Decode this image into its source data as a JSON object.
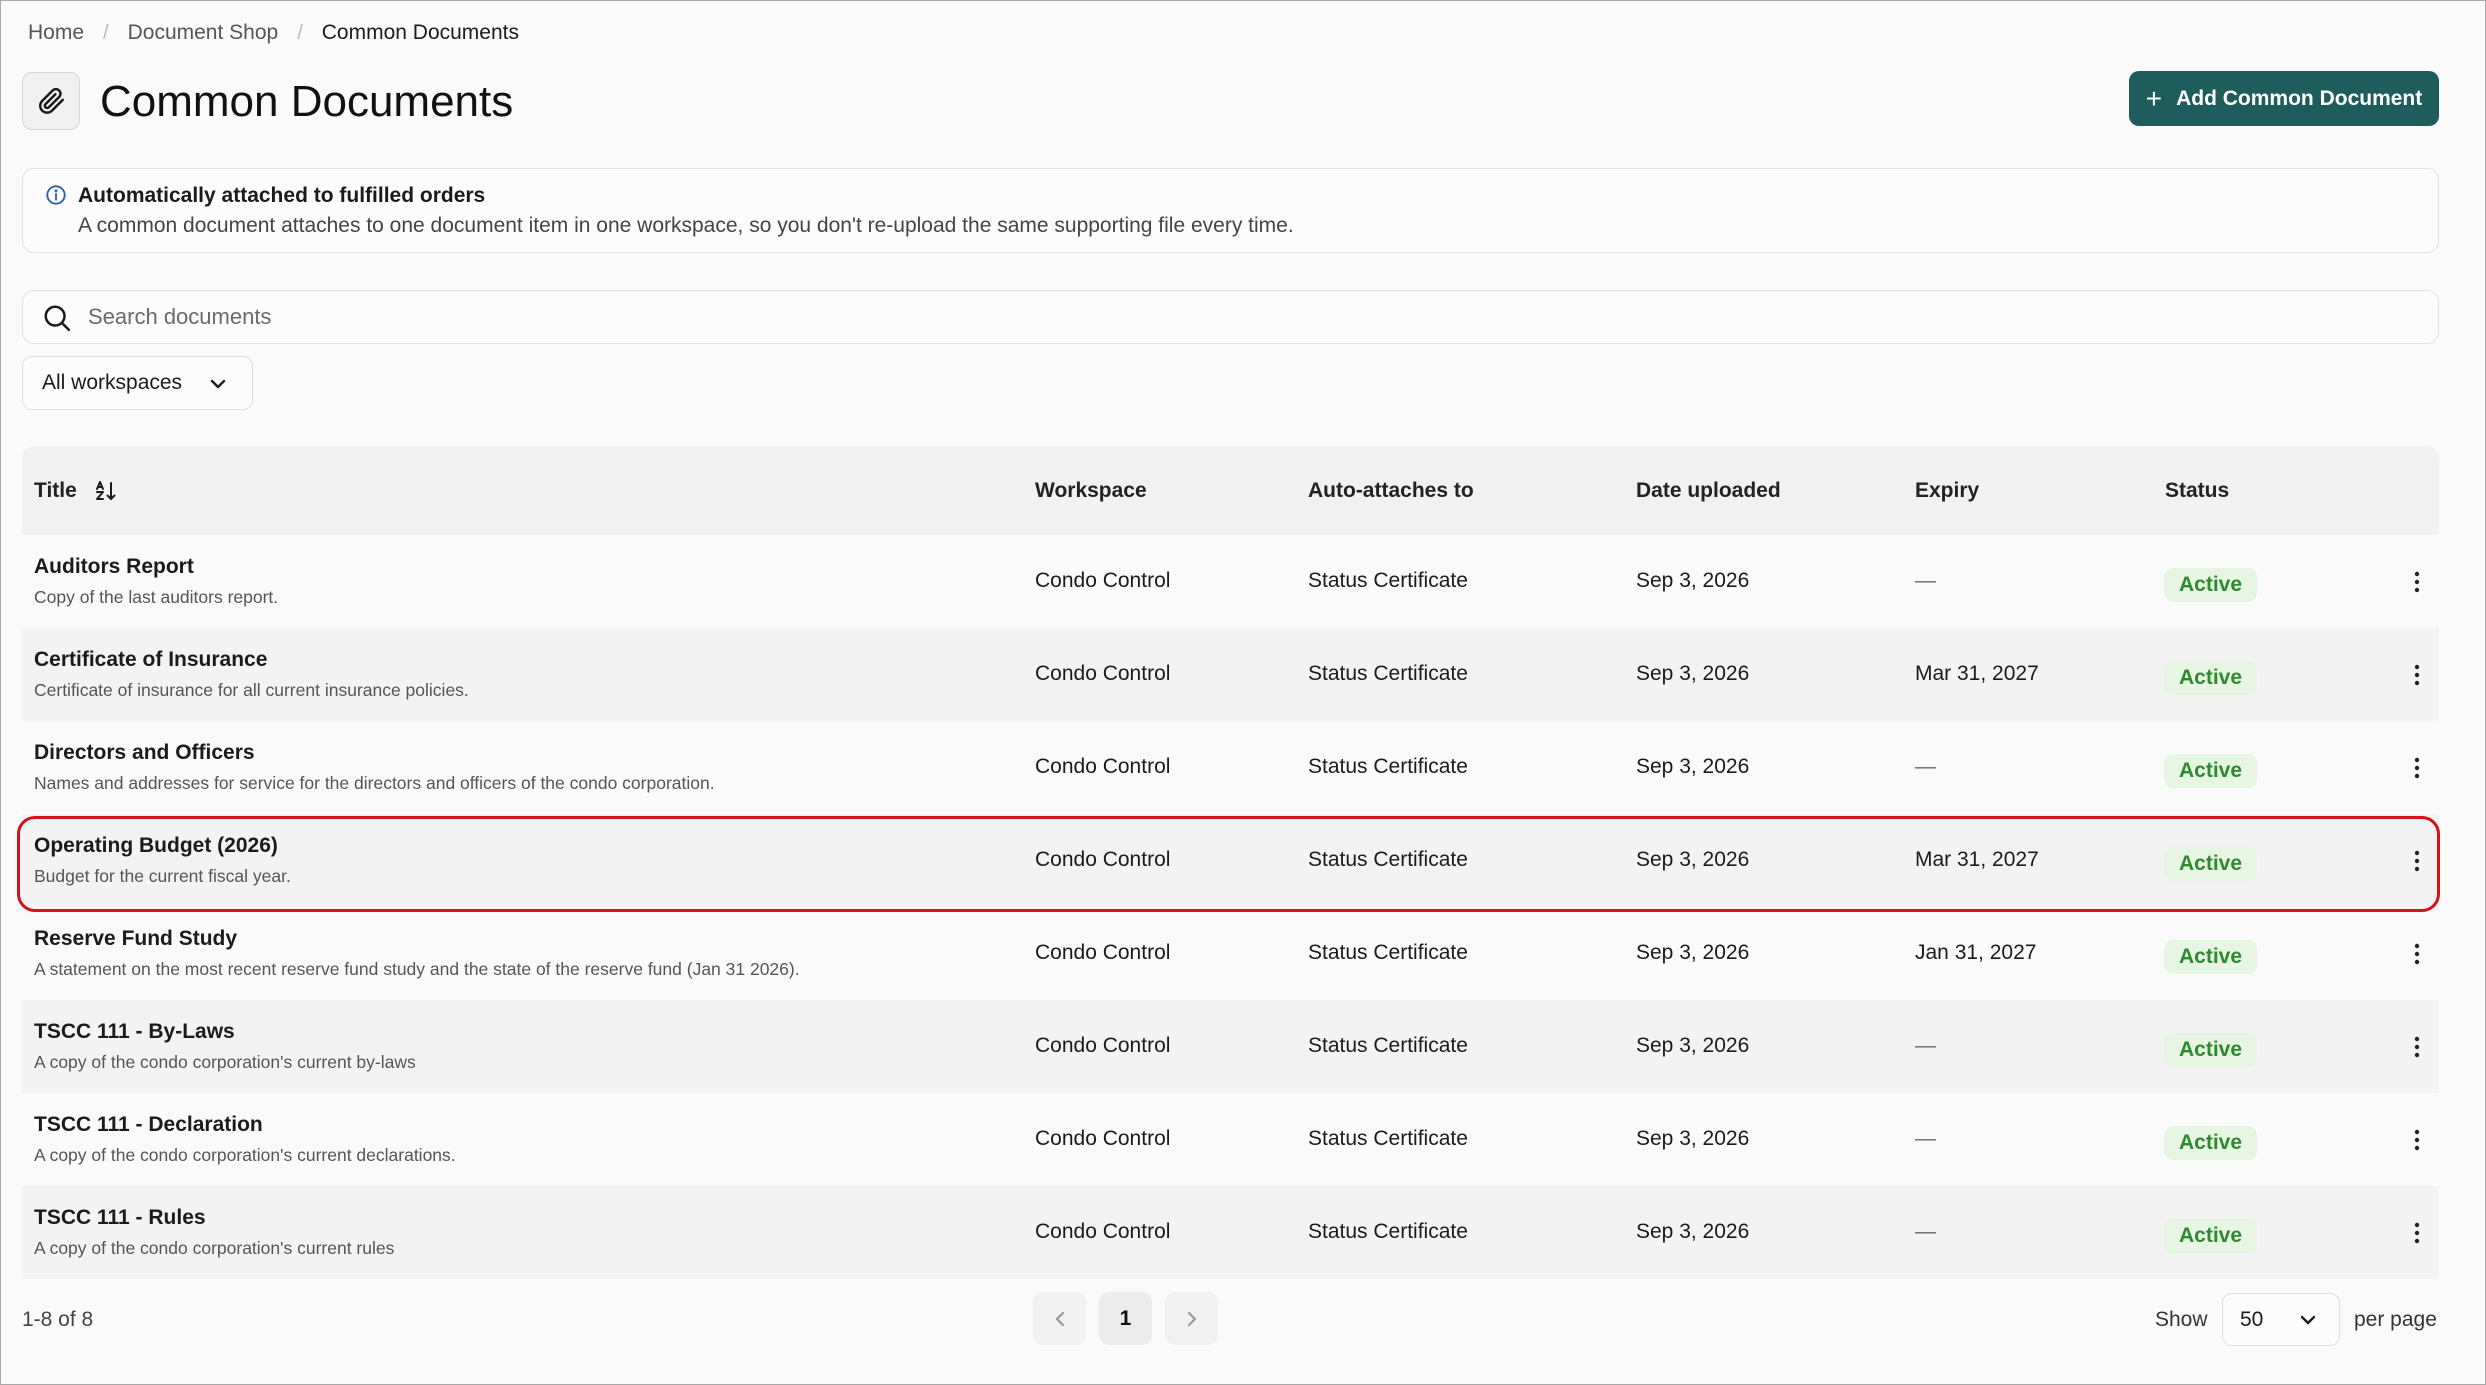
{
  "breadcrumb": [
    "Home",
    "Document Shop",
    "Common Documents"
  ],
  "breadcrumb_separator": "/",
  "page": {
    "title": "Common Documents",
    "title_icon": "paperclip-icon",
    "add_button_label": "Add Common Document"
  },
  "notice": {
    "icon": "info-icon",
    "title": "Automatically attached to fulfilled orders",
    "text": "A common document attaches to one document item in one workspace, so you don't re-upload the same supporting file every time."
  },
  "search": {
    "placeholder": "Search documents",
    "value": ""
  },
  "filter": {
    "workspace_selected": "All workspaces"
  },
  "table": {
    "columns": {
      "title": "Title",
      "workspace": "Workspace",
      "auto_attaches": "Auto-attaches to",
      "date_uploaded": "Date uploaded",
      "expiry": "Expiry",
      "status": "Status"
    },
    "rows": [
      {
        "title": "Auditors Report",
        "description": "Copy of the last auditors report.",
        "workspace": "Condo Control",
        "auto_attaches": "Status Certificate",
        "date_uploaded": "Sep 3, 2026",
        "expiry": "—",
        "status": "Active"
      },
      {
        "title": "Certificate of Insurance",
        "description": "Certificate of insurance for all current insurance policies.",
        "workspace": "Condo Control",
        "auto_attaches": "Status Certificate",
        "date_uploaded": "Sep 3, 2026",
        "expiry": "Mar 31, 2027",
        "status": "Active"
      },
      {
        "title": "Directors and Officers",
        "description": "Names and addresses for service for the directors and officers of the condo corporation.",
        "workspace": "Condo Control",
        "auto_attaches": "Status Certificate",
        "date_uploaded": "Sep 3, 2026",
        "expiry": "—",
        "status": "Active"
      },
      {
        "title": "Operating Budget (2026)",
        "description": "Budget for the current fiscal year.",
        "workspace": "Condo Control",
        "auto_attaches": "Status Certificate",
        "date_uploaded": "Sep 3, 2026",
        "expiry": "Mar 31, 2027",
        "status": "Active"
      },
      {
        "title": "Reserve Fund Study",
        "description": "A statement on the most recent reserve fund study and the state of the reserve fund (Jan 31 2026).",
        "workspace": "Condo Control",
        "auto_attaches": "Status Certificate",
        "date_uploaded": "Sep 3, 2026",
        "expiry": "Jan 31, 2027",
        "status": "Active"
      },
      {
        "title": "TSCC 111 - By-Laws",
        "description": "A copy of the condo corporation's current by-laws",
        "workspace": "Condo Control",
        "auto_attaches": "Status Certificate",
        "date_uploaded": "Sep 3, 2026",
        "expiry": "—",
        "status": "Active"
      },
      {
        "title": "TSCC 111 - Declaration",
        "description": "A copy of the condo corporation's current declarations.",
        "workspace": "Condo Control",
        "auto_attaches": "Status Certificate",
        "date_uploaded": "Sep 3, 2026",
        "expiry": "—",
        "status": "Active"
      },
      {
        "title": "TSCC 111 - Rules",
        "description": "A copy of the condo corporation's current rules",
        "workspace": "Condo Control",
        "auto_attaches": "Status Certificate",
        "date_uploaded": "Sep 3, 2026",
        "expiry": "—",
        "status": "Active"
      }
    ]
  },
  "pagination": {
    "range": "1-8 of 8",
    "current_page": "1",
    "show_label": "Show",
    "per_page_value": "50",
    "per_page_label": "per page"
  },
  "colors": {
    "primary_button": "#1f5c5c",
    "status_active_bg": "#e7f5e3",
    "status_active_text": "#2f8a2f",
    "highlight_border": "#d4121a"
  }
}
